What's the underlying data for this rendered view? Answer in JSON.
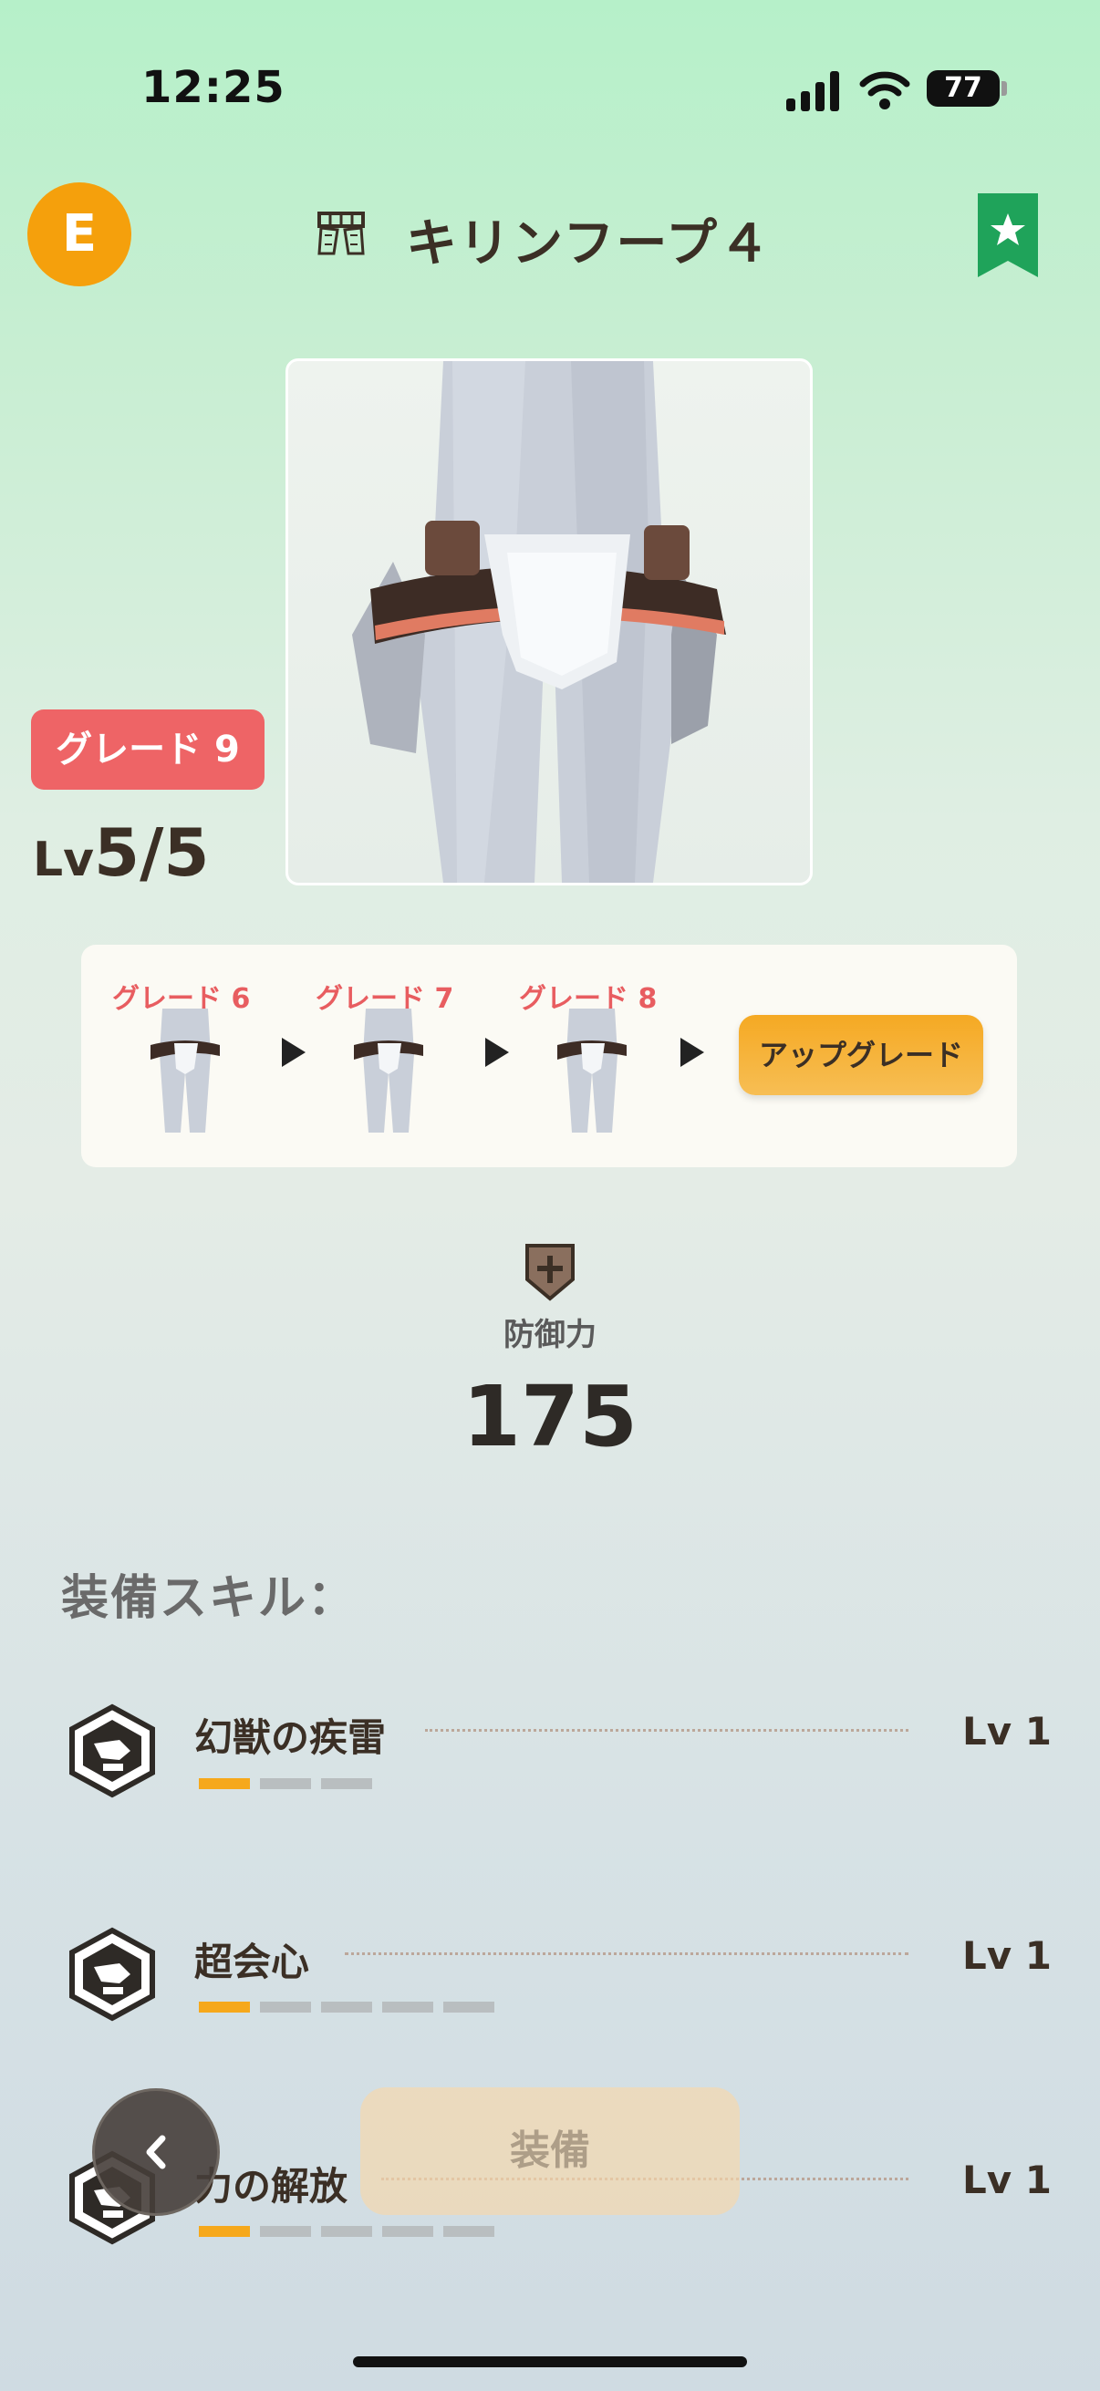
{
  "status_bar": {
    "time": "12:25",
    "battery": "77"
  },
  "header": {
    "rank_badge": "E",
    "title": "キリンフープ４",
    "armor_icon": "waist-armor-icon",
    "bookmark_icon": "star-bookmark-icon"
  },
  "item": {
    "grade_badge": "グレード 9",
    "level_prefix": "Lv",
    "level_value": "5/5",
    "image_icon": "kirin-waist-armor-image"
  },
  "upgrade_path": {
    "steps": [
      {
        "label": "グレード 6"
      },
      {
        "label": "グレード 7"
      },
      {
        "label": "グレード 8"
      }
    ],
    "button_label": "アップグレード"
  },
  "defense": {
    "icon": "shield-cross-icon",
    "label": "防御力",
    "value": "175"
  },
  "skills": {
    "header": "装備スキル：",
    "items": [
      {
        "name": "幻獣の疾雷",
        "level": "Lv 1",
        "filled": 1,
        "max": 3,
        "icon": "skill-hexagon-icon"
      },
      {
        "name": "超会心",
        "level": "Lv 1",
        "filled": 1,
        "max": 5,
        "icon": "skill-hexagon-icon"
      },
      {
        "name": "力の解放",
        "level": "Lv 1",
        "filled": 1,
        "max": 5,
        "icon": "skill-hexagon-icon"
      }
    ]
  },
  "bottom": {
    "back_icon": "chevron-left-icon",
    "equip_label": "装備"
  },
  "colors": {
    "accent_orange": "#f5a00c",
    "grade_red": "#ee6466",
    "bookmark_green": "#1fa35a",
    "bar_on": "#f6a81b",
    "bar_off": "#b9bec0"
  }
}
